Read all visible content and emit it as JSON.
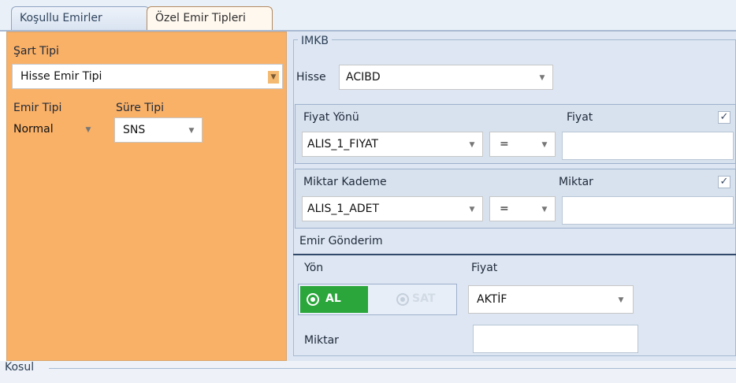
{
  "tabs": [
    {
      "label": "Koşullu Emirler"
    },
    {
      "label": "Özel Emir Tipleri"
    }
  ],
  "left": {
    "sart_tipi_label": "Şart Tipi",
    "sart_tipi_value": "Hisse Emir Tipi",
    "emir_tipi_label": "Emir Tipi",
    "emir_tipi_value": "Normal",
    "sure_tipi_label": "Süre Tipi",
    "sure_tipi_value": "SNS"
  },
  "right": {
    "imkb_label": "IMKB",
    "hisse_label": "Hisse",
    "hisse_value": "ACIBD",
    "fiyat_yonu": {
      "label": "Fiyat Yönü",
      "fiyat_label": "Fiyat",
      "select_value": "ALIS_1_FIYAT",
      "operator": "=",
      "input_value": "",
      "checkbox": "✓"
    },
    "miktar_kademe": {
      "label": "Miktar Kademe",
      "miktar_label": "Miktar",
      "select_value": "ALIS_1_ADET",
      "operator": "=",
      "input_value": "",
      "checkbox": "✓"
    },
    "emir_gonderim": {
      "label": "Emir Gönderim",
      "yon_label": "Yön",
      "fiyat_label": "Fiyat",
      "al_label": "AL",
      "sat_label": "SAT",
      "fiyat_value": "AKTİF",
      "miktar_label": "Miktar",
      "miktar_value": ""
    }
  },
  "bottom": {
    "kosul_label": "Kosul"
  },
  "colors": {
    "left_panel": "#f9b067",
    "right_panel": "#dde6f2",
    "al_active": "#2aa63b"
  },
  "icons": [
    "chevron-down-icon",
    "radio-selected-icon",
    "radio-unselected-icon",
    "check-icon"
  ]
}
